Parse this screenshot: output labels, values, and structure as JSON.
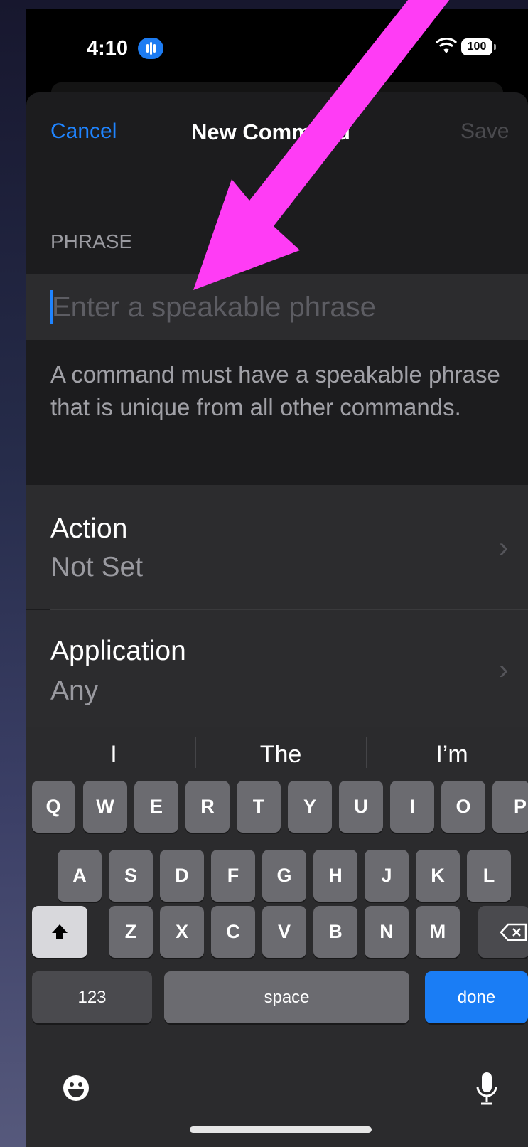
{
  "status_bar": {
    "time": "4:10",
    "battery": "100"
  },
  "nav": {
    "cancel": "Cancel",
    "title": "New Command",
    "save": "Save"
  },
  "phrase_section": {
    "header": "PHRASE",
    "placeholder": "Enter a speakable phrase",
    "value": "",
    "footer": "A command must have a speakable phrase that is unique from all other commands."
  },
  "rows": [
    {
      "title": "Action",
      "value": "Not Set"
    },
    {
      "title": "Application",
      "value": "Any"
    }
  ],
  "keyboard": {
    "suggestions": [
      "I",
      "The",
      "I’m"
    ],
    "row1": [
      "Q",
      "W",
      "E",
      "R",
      "T",
      "Y",
      "U",
      "I",
      "O",
      "P"
    ],
    "row2": [
      "A",
      "S",
      "D",
      "F",
      "G",
      "H",
      "J",
      "K",
      "L"
    ],
    "row3": [
      "Z",
      "X",
      "C",
      "V",
      "B",
      "N",
      "M"
    ],
    "numbers": "123",
    "space": "space",
    "done": "done",
    "accent_color": "#1a7df5"
  },
  "annotation": {
    "arrow_color": "#ff3cf5"
  },
  "icons": [
    "wifi-icon",
    "battery-icon",
    "chevron-right-icon",
    "shift-icon",
    "delete-icon",
    "emoji-icon",
    "microphone-icon"
  ]
}
